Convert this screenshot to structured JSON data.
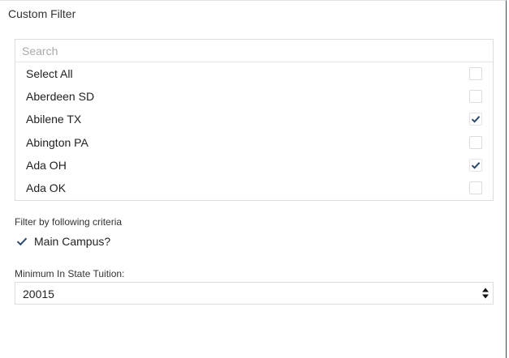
{
  "title": "Custom Filter",
  "search": {
    "placeholder": "Search",
    "value": ""
  },
  "items": [
    {
      "label": "Select All",
      "checked": false
    },
    {
      "label": "Aberdeen SD",
      "checked": false
    },
    {
      "label": "Abilene TX",
      "checked": true
    },
    {
      "label": "Abington PA",
      "checked": false
    },
    {
      "label": "Ada OH",
      "checked": true
    },
    {
      "label": "Ada OK",
      "checked": false
    }
  ],
  "criteria": {
    "heading": "Filter by following criteria",
    "main_campus": {
      "label": "Main Campus?",
      "checked": true
    }
  },
  "tuition": {
    "label": "Minimum In State Tuition:",
    "value": "20015"
  },
  "colors": {
    "check": "#2c4a6b",
    "border": "#dddddd",
    "panel_edge": "#2f4a6a"
  }
}
